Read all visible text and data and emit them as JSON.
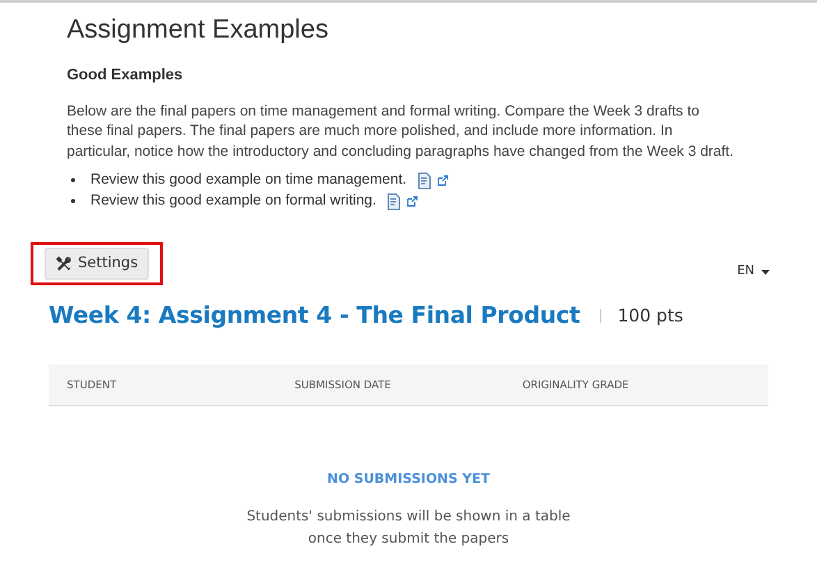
{
  "content": {
    "title": "Assignment Examples",
    "subtitle": "Good Examples",
    "paragraph": "Below are the final papers on time management and formal writing. Compare the Week 3 drafts to these final papers. The final papers are much more polished, and include more information. In particular, notice how the introductory and concluding paragraphs have changed from the Week 3 draft.",
    "links": [
      {
        "label": "Review this good example on time management."
      },
      {
        "label": "Review this good example on formal writing."
      }
    ]
  },
  "settings_button": {
    "label": "Settings",
    "highlighted": true
  },
  "language": "EN",
  "assignment": {
    "title": "Week 4: Assignment 4 - The Final Product",
    "points": "100 pts"
  },
  "table": {
    "columns": [
      "STUDENT",
      "SUBMISSION DATE",
      "ORIGINALITY GRADE"
    ]
  },
  "empty_state": {
    "heading": "NO SUBMISSIONS YET",
    "lines": [
      "Students' submissions will be shown in a table",
      "once they submit the papers"
    ]
  }
}
